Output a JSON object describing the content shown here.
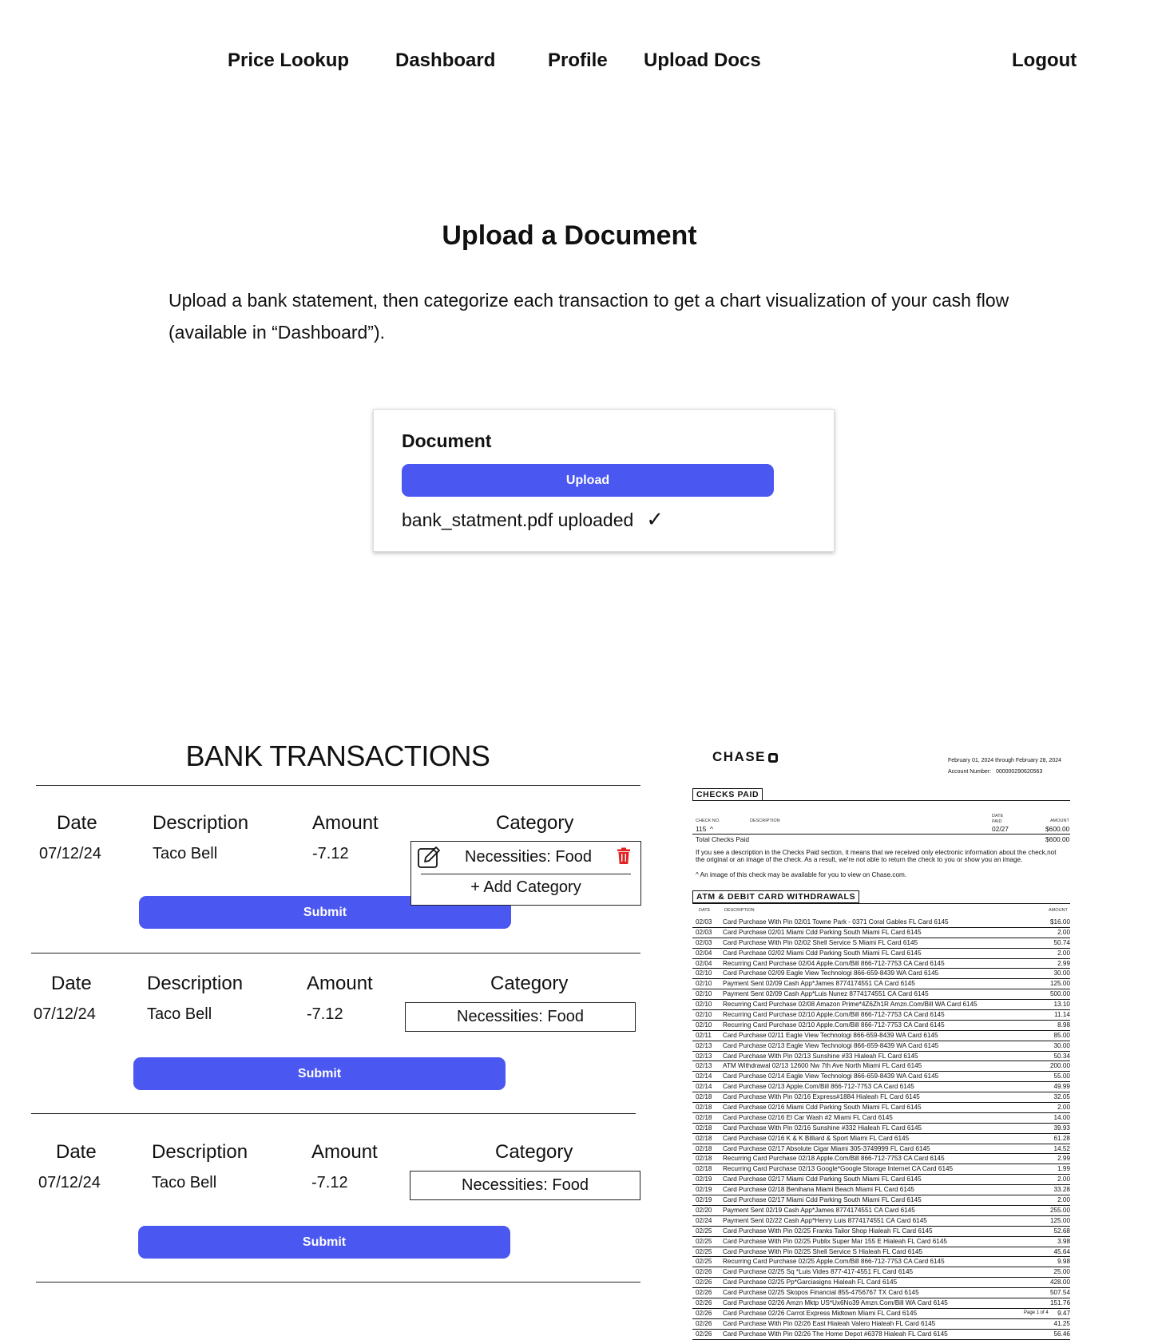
{
  "nav": {
    "price_lookup": "Price Lookup",
    "dashboard": "Dashboard",
    "profile": "Profile",
    "upload_docs": "Upload Docs",
    "logout": "Logout"
  },
  "page": {
    "title": "Upload a Document",
    "intro": "Upload a bank statement, then categorize each transaction to get a chart visualization of your cash flow (available in “Dashboard”)."
  },
  "upload": {
    "label": "Document",
    "button": "Upload",
    "status": "bank_statment.pdf uploaded",
    "status_icon": "✓"
  },
  "transactions": {
    "title": "BANK TRANSACTIONS",
    "headers": {
      "date": "Date",
      "description": "Description",
      "amount": "Amount",
      "category": "Category"
    },
    "submit_label": "Submit",
    "rows": [
      {
        "date": "07/12/24",
        "description": "Taco Bell",
        "amount": "-7.12",
        "category": "Necessities: Food"
      },
      {
        "date": "07/12/24",
        "description": "Taco Bell",
        "amount": "-7.12",
        "category": "Necessities: Food"
      },
      {
        "date": "07/12/24",
        "description": "Taco Bell",
        "amount": "-7.12",
        "category": "Necessities: Food"
      }
    ],
    "dropdown": {
      "selected": "Necessities: Food",
      "add_label": "+ Add Category",
      "edit_icon": "edit-icon",
      "delete_icon": "trash-icon",
      "delete_color": "#e02424"
    }
  },
  "statement": {
    "bank": "CHASE",
    "period": "February 01, 2024 through February 28, 2024",
    "account_label": "Account Number:",
    "account_number": "000000290620563",
    "checks": {
      "title": "CHECKS PAID",
      "col_check_no": "CHECK NO.",
      "col_description": "DESCRIPTION",
      "col_date_paid": "DATE PAID",
      "col_amount": "AMOUNT",
      "check_no": "115",
      "check_mark": "^",
      "date_paid": "02/27",
      "amount": "$600.00",
      "total_label": "Total Checks Paid",
      "total": "$600.00",
      "note1": "If you see a description in the Checks Paid section, it means that we received only electronic information about the check,not the original or an image of the check. As a result, we're not able to return the check to you or show you an image.",
      "note2": "^ An image of this check may be available for you to view on Chase.com."
    },
    "withdrawals": {
      "title": "ATM & DEBIT CARD WITHDRAWALS",
      "col_date": "DATE",
      "col_description": "DESCRIPTION",
      "col_amount": "AMOUNT",
      "rows": [
        [
          "02/03",
          "Card Purchase With Pin  02/01 Towne Park - 0371 Coral Gables FL Card 6145",
          "$16.00"
        ],
        [
          "02/03",
          "Card Purchase              02/01 Miami Cdd Parking South Miami FL Card 6145",
          "2.00"
        ],
        [
          "02/03",
          "Card Purchase With Pin  02/02 Shell Service S Miami FL Card 6145",
          "50.74"
        ],
        [
          "02/04",
          "Card Purchase              02/02 Miami Cdd Parking South Miami FL Card 6145",
          "2.00"
        ],
        [
          "02/04",
          "Recurring Card Purchase 02/04 Apple.Com/Bill 866-712-7753 CA Card 6145",
          "2.99"
        ],
        [
          "02/10",
          "Card Purchase              02/09 Eagle View Technologi 866-659-8439 WA Card 6145",
          "30.00"
        ],
        [
          "02/10",
          "Payment Sent               02/09 Cash App*James 8774174551 CA Card 6145",
          "125.00"
        ],
        [
          "02/10",
          "Payment Sent               02/09 Cash App*Luis Nunez 8774174551 CA Card 6145",
          "500.00"
        ],
        [
          "02/10",
          "Recurring Card Purchase 02/08 Amazon Prime*4Z6Zh1R Amzn.Com/Bill WA Card 6145",
          "13.10"
        ],
        [
          "02/10",
          "Recurring Card Purchase 02/10 Apple.Com/Bill 866-712-7753 CA Card 6145",
          "11.14"
        ],
        [
          "02/10",
          "Recurring Card Purchase 02/10 Apple.Com/Bill 866-712-7753 CA Card 6145",
          "8.98"
        ],
        [
          "02/11",
          "Card Purchase              02/11 Eagle View Technologi 866-659-8439 WA Card 6145",
          "85.00"
        ],
        [
          "02/13",
          "Card Purchase              02/13 Eagle View Technologi 866-659-8439 WA Card 6145",
          "30.00"
        ],
        [
          "02/13",
          "Card Purchase With Pin  02/13 Sunshine #33 Hialeah FL Card 6145",
          "50.34"
        ],
        [
          "02/13",
          "ATM Withdrawal            02/13 12600 Nw 7th Ave North Miami FL Card 6145",
          "200.00"
        ],
        [
          "02/14",
          "Card Purchase              02/14 Eagle View Technologi 866-659-8439 WA Card 6145",
          "55.00"
        ],
        [
          "02/14",
          "Card Purchase              02/13 Apple.Com/Bill 866-712-7753 CA Card 6145",
          "49.99"
        ],
        [
          "02/18",
          "Card Purchase With Pin  02/16 Express#1884 Hialeah FL Card 6145",
          "32.05"
        ],
        [
          "02/18",
          "Card Purchase              02/16 Miami Cdd Parking South Miami FL Card 6145",
          "2.00"
        ],
        [
          "02/18",
          "Card Purchase              02/16 El Car Wash #2 Miami FL Card 6145",
          "14.00"
        ],
        [
          "02/18",
          "Card Purchase With Pin  02/16 Sunshine #332 Hialeah FL Card 6145",
          "39.93"
        ],
        [
          "02/18",
          "Card Purchase              02/16 K & K Billiard & Sport Miami FL Card 6145",
          "61.28"
        ],
        [
          "02/18",
          "Card Purchase              02/17 Absolute Cigar Miami 305-3749999 FL Card 6145",
          "14.52"
        ],
        [
          "02/18",
          "Recurring Card Purchase 02/18 Apple.Com/Bill 866-712-7753 CA Card 6145",
          "2.99"
        ],
        [
          "02/18",
          "Recurring Card Purchase 02/13 Google*Google Storage Internet CA Card 6145",
          "1.99"
        ],
        [
          "02/19",
          "Card Purchase              02/17 Miami Cdd Parking South Miami FL Card 6145",
          "2.00"
        ],
        [
          "02/19",
          "Card Purchase              02/18 Benihana Miami Beach Miami FL Card 6145",
          "33.28"
        ],
        [
          "02/19",
          "Card Purchase              02/17 Miami Cdd Parking South Miami FL Card 6145",
          "2.00"
        ],
        [
          "02/20",
          "Payment Sent               02/19 Cash App*James 8774174551 CA Card 6145",
          "255.00"
        ],
        [
          "02/24",
          "Payment Sent               02/22 Cash App*Henry Luis 8774174551 CA Card 6145",
          "125.00"
        ],
        [
          "02/25",
          "Card Purchase With Pin  02/25 Franks Tailor Shop Hialeah FL Card 6145",
          "52.68"
        ],
        [
          "02/25",
          "Card Purchase With Pin  02/25 Publix Super Mar 155 E Hialeah FL Card 6145",
          "3.98"
        ],
        [
          "02/25",
          "Card Purchase With Pin  02/25 Shell Service S Hialeah FL Card 6145",
          "45.64"
        ],
        [
          "02/25",
          "Recurring Card Purchase 02/25 Apple.Com/Bill 866-712-7753 CA Card 6145",
          "9.98"
        ],
        [
          "02/26",
          "Card Purchase              02/25 Sq *Luis Vides 877-417-4551 FL Card 6145",
          "25.00"
        ],
        [
          "02/26",
          "Card Purchase              02/25 Pp*Garciasigns Hialeah FL Card 6145",
          "428.00"
        ],
        [
          "02/26",
          "Card Purchase              02/25 Skopos  Financial 855-4756767 TX Card 6145",
          "507.54"
        ],
        [
          "02/26",
          "Card Purchase              02/26 Amzn Mktp US*Ux6No39 Amzn.Com/Bill WA Card 6145",
          "151.76"
        ],
        [
          "02/26",
          "Card Purchase              02/26 Carrot Express Midtown Miami FL Card 6145",
          "9.47"
        ],
        [
          "02/26",
          "Card Purchase With Pin  02/26 East Hialeah Valero Hialeah FL Card 6145",
          "41.25"
        ],
        [
          "02/26",
          "Card Purchase With Pin  02/26 The Home Depot #6378 Hialeah FL Card 6145",
          "56.46"
        ]
      ]
    },
    "page_label": "Page 1 of 4"
  }
}
